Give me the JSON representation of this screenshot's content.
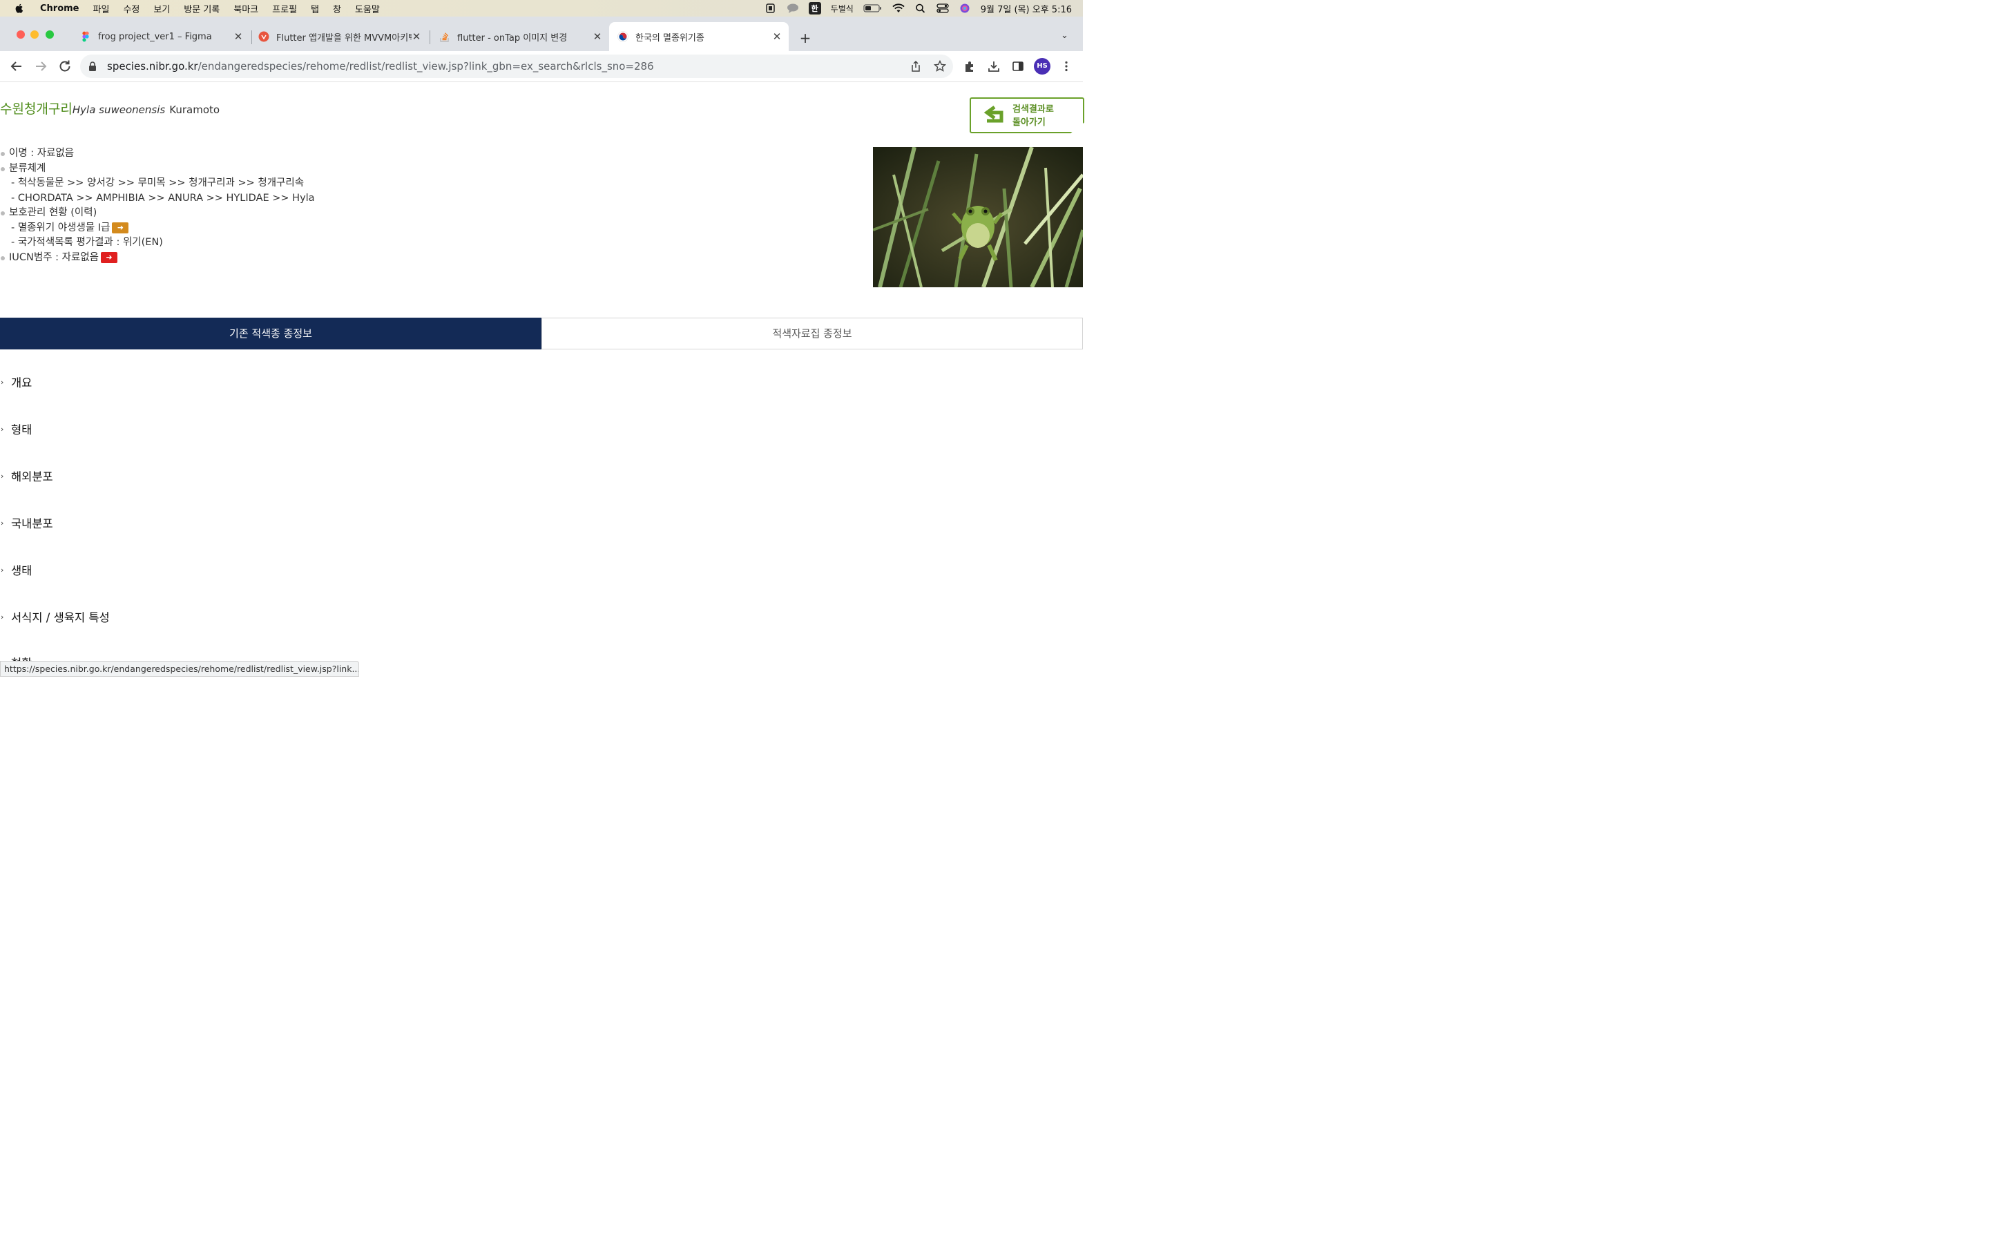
{
  "menubar": {
    "app": "Chrome",
    "items": [
      "파일",
      "수정",
      "보기",
      "방문 기록",
      "북마크",
      "프로필",
      "탭",
      "창",
      "도움말"
    ],
    "input_method_badge": "한",
    "input_method_name": "두벌식",
    "clock": "9월 7일 (목) 오후 5:16"
  },
  "tabs": [
    {
      "title": "frog project_ver1 – Figma",
      "icon": "figma-icon"
    },
    {
      "title": "Flutter 앱개발을 위한 MVVM아키텍처",
      "icon": "velog-icon"
    },
    {
      "title": "flutter - onTap 이미지 변경",
      "icon": "stackoverflow-icon"
    },
    {
      "title": "한국의 멸종위기종",
      "icon": "korea-flag-icon"
    }
  ],
  "toolbar": {
    "url_host": "species.nibr.go.kr",
    "url_path": "/endangeredspecies/rehome/redlist/redlist_view.jsp?link_gbn=ex_search&rlcls_sno=286",
    "profile_initials": "HS"
  },
  "species": {
    "korean_name": "수원청개구리",
    "scientific_name": "Hyla suweonensis",
    "author": "Kuramoto"
  },
  "back_button": {
    "line1": "검색결과로",
    "line2": "돌아가기"
  },
  "info": {
    "common_name": "이명 : 자료없음",
    "taxonomy_label": "분류체계",
    "taxonomy_ko": "- 척삭동물문 >> 양서강 >> 무미목 >> 청개구리과 >> 청개구리속",
    "taxonomy_en": "- CHORDATA >> AMPHIBIA >> ANURA >> HYLIDAE >> Hyla",
    "protection_label": "보호관리 현황 (이력)",
    "protection_grade": "- 멸종위기 야생생물 Ⅰ급",
    "national_redlist": "- 국가적색목록 평가결과 : 위기(EN)",
    "iucn": "IUCN범주 : 자료없음",
    "arrow": "➜"
  },
  "content_tabs": {
    "left": "기존 적색종 종정보",
    "right": "적색자료집 종정보"
  },
  "sections": [
    "개요",
    "형태",
    "해외분포",
    "국내분포",
    "생태",
    "서식지 / 생육지 특성",
    "현황"
  ],
  "status_url": "https://species.nibr.go.kr/endangeredspecies/rehome/redlist/redlist_view.jsp?link...",
  "colors": {
    "accent_green": "#4e8c1a",
    "tab_navy": "#132a56",
    "badge_orange": "#d38a1d",
    "badge_red": "#e02020"
  }
}
